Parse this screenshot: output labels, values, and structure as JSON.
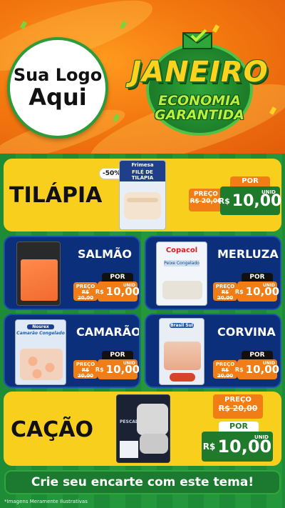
{
  "header": {
    "logo_line1": "Sua Logo",
    "logo_line2": "Aqui",
    "campaign_title": "JANEIRO",
    "campaign_subtitle_1": "ECONOMIA",
    "campaign_subtitle_2": "GARANTIDA"
  },
  "products": [
    {
      "name": "TILÁPIA",
      "brand": "Frimesa",
      "pkg_title": "FILÉ DE TILÁPIA",
      "discount": "-50%",
      "old_label": "PREÇO",
      "old_price": "R$ 20,00",
      "por": "POR",
      "currency": "R$",
      "new_price": "10,00",
      "unit": "UNID"
    },
    {
      "name": "SALMÃO",
      "old_label": "PREÇO",
      "old_price": "R$ 20,00",
      "por": "POR",
      "currency": "R$",
      "new_price": "10,00",
      "unit": "UNID"
    },
    {
      "name": "MERLUZA",
      "brand": "Copacol",
      "pkg_title": "Peixe Congelado",
      "old_label": "PREÇO",
      "old_price": "R$ 20,00",
      "por": "POR",
      "currency": "R$",
      "new_price": "10,00",
      "unit": "UNID"
    },
    {
      "name": "CAMARÃO",
      "brand": "Nosrex",
      "pkg_title": "Camarão Congelado",
      "old_label": "PREÇO",
      "old_price": "R$ 20,00",
      "por": "POR",
      "currency": "R$",
      "new_price": "10,00",
      "unit": "UNID"
    },
    {
      "name": "CORVINA",
      "brand": "Brasil Sul",
      "old_label": "PREÇO",
      "old_price": "R$ 20,00",
      "por": "POR",
      "currency": "R$",
      "new_price": "10,00",
      "unit": "UNID"
    },
    {
      "name": "CAÇÃO",
      "pkg_title": "PESCADOS",
      "old_label": "PREÇO",
      "old_price": "R$ 20,00",
      "por": "POR",
      "currency": "R$",
      "new_price": "10,00",
      "unit": "UNID"
    }
  ],
  "cta": "Crie seu encarte com este tema!",
  "disclaimer": "*Imagens Meramente Ilustrativas",
  "colors": {
    "header_orange": "#f47a10",
    "card_yellow": "#f7cf1c",
    "card_blue": "#0b2f7a",
    "price_green": "#1f7a2c",
    "price_orange": "#f07d16",
    "background_green": "#1e8b37"
  }
}
